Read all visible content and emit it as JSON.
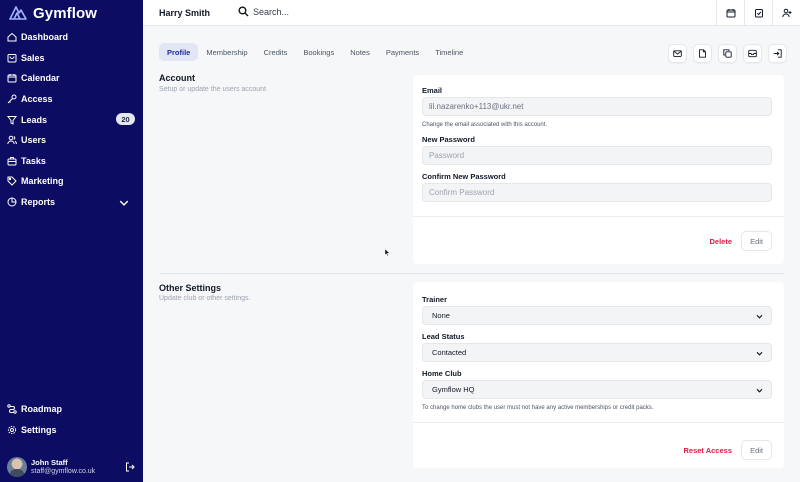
{
  "app": {
    "name": "Gymflow"
  },
  "sidebar": {
    "items": [
      {
        "label": "Dashboard",
        "icon": "home-icon"
      },
      {
        "label": "Sales",
        "icon": "cart-icon"
      },
      {
        "label": "Calendar",
        "icon": "calendar-icon"
      },
      {
        "label": "Access",
        "icon": "key-icon"
      },
      {
        "label": "Leads",
        "icon": "funnel-icon",
        "badge": "20"
      },
      {
        "label": "Users",
        "icon": "users-icon"
      },
      {
        "label": "Tasks",
        "icon": "briefcase-icon"
      },
      {
        "label": "Marketing",
        "icon": "tag-icon"
      },
      {
        "label": "Reports",
        "icon": "pie-icon"
      }
    ],
    "bottom": [
      {
        "label": "Roadmap",
        "icon": "route-icon"
      },
      {
        "label": "Settings",
        "icon": "gear-icon"
      }
    ],
    "user": {
      "name": "John Staff",
      "email": "staff@gymflow.co.uk"
    }
  },
  "topbar": {
    "user_name": "Harry Smith",
    "search_placeholder": "Search..."
  },
  "tabs": [
    "Profile",
    "Membership",
    "Credits",
    "Bookings",
    "Notes",
    "Payments",
    "Timeline"
  ],
  "active_tab": "Profile",
  "account": {
    "title": "Account",
    "subtitle": "Setup or update the users account",
    "email_label": "Email",
    "email_value": "lil.nazarenko+113@ukr.net",
    "email_help": "Change the email associated with this account.",
    "new_password_label": "New Password",
    "new_password_placeholder": "Password",
    "confirm_password_label": "Confirm New Password",
    "confirm_password_placeholder": "Confirm Password",
    "delete_label": "Delete",
    "edit_label": "Edit"
  },
  "other": {
    "title": "Other Settings",
    "subtitle": "Update club or other settings.",
    "trainer_label": "Trainer",
    "trainer_value": "None",
    "lead_status_label": "Lead Status",
    "lead_status_value": "Contacted",
    "home_club_label": "Home Club",
    "home_club_value": "Gymflow HQ",
    "home_club_help": "To change home clubs the user must not have any active memberships or credit packs.",
    "reset_label": "Reset Access",
    "edit_label": "Edit"
  },
  "colors": {
    "sidebar_bg": "#0c0c62",
    "danger": "#e11d48",
    "tab_active_bg": "#e3e6f5"
  }
}
